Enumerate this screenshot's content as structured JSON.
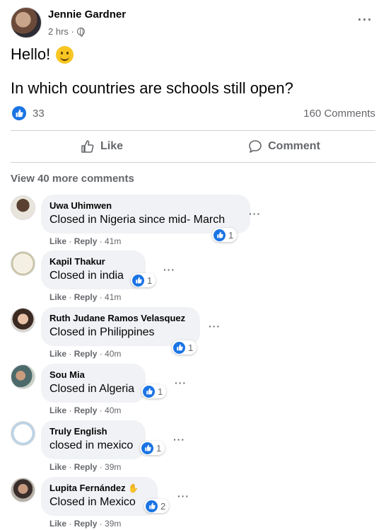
{
  "post": {
    "author": "Jennie Gardner",
    "time": "2 hrs ·",
    "line1": "Hello!",
    "line2": "In which countries are schools still open?",
    "likes": "33",
    "comments_count": "160 Comments"
  },
  "actions": {
    "like": "Like",
    "comment": "Comment"
  },
  "view_more": "View 40 more comments",
  "comments": [
    {
      "name": "Uwa Uhimwen",
      "text": "Closed in Nigeria since mid- March",
      "reactions": "1",
      "time": "41m"
    },
    {
      "name": "Kapil Thakur",
      "text": "Closed in india",
      "reactions": "1",
      "time": "41m"
    },
    {
      "name": "Ruth Judane Ramos Velasquez",
      "text": "Closed in Philippines",
      "reactions": "1",
      "time": "40m"
    },
    {
      "name": "Sou Mia",
      "text": "Closed in Algeria",
      "reactions": "1",
      "time": "40m"
    },
    {
      "name": "Truly English",
      "text": "closed in mexico",
      "reactions": "1",
      "time": "39m"
    },
    {
      "name": "Lupita Fernández",
      "text": "Closed in Mexico",
      "reactions": "2",
      "time": "39m"
    }
  ],
  "comment_actions": {
    "like": "Like",
    "reply": "Reply"
  },
  "colors": {
    "accent": "#1b74e4",
    "muted": "#65676b",
    "bubble": "#f0f2f5"
  }
}
